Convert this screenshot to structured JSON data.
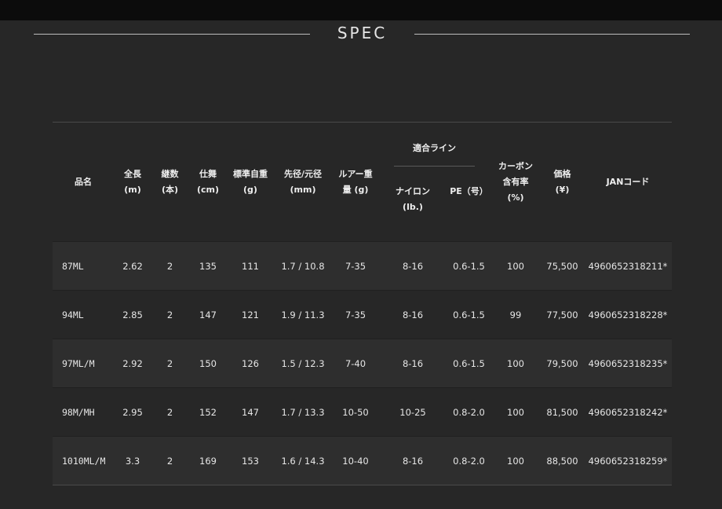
{
  "heading": {
    "title": "SPEC"
  },
  "headers": {
    "model": "品名",
    "length": "全長\n(m)",
    "sections": "継数\n(本)",
    "closed": "仕舞\n(cm)",
    "weight": "標準自重\n(g)",
    "diameter": "先径/元径\n(mm)",
    "lure": "ルアー重\n量 (g)",
    "line_group": "適合ライン",
    "nylon": "ナイロン\n(lb.)",
    "pe": "PE（号）",
    "carbon": "カーボン\n含有率\n(%)",
    "price": "価格\n(¥)",
    "jan": "JANコード"
  },
  "rows": [
    {
      "model": "87ML",
      "length": "2.62",
      "sections": "2",
      "closed": "135",
      "weight": "111",
      "diameter": "1.7 / 10.8",
      "lure": "7-35",
      "nylon": "8-16",
      "pe": "0.6-1.5",
      "carbon": "100",
      "price": "75,500",
      "jan": "4960652318211*"
    },
    {
      "model": "94ML",
      "length": "2.85",
      "sections": "2",
      "closed": "147",
      "weight": "121",
      "diameter": "1.9 / 11.3",
      "lure": "7-35",
      "nylon": "8-16",
      "pe": "0.6-1.5",
      "carbon": "99",
      "price": "77,500",
      "jan": "4960652318228*"
    },
    {
      "model": "97ML/M",
      "length": "2.92",
      "sections": "2",
      "closed": "150",
      "weight": "126",
      "diameter": "1.5 / 12.3",
      "lure": "7-40",
      "nylon": "8-16",
      "pe": "0.6-1.5",
      "carbon": "100",
      "price": "79,500",
      "jan": "4960652318235*"
    },
    {
      "model": "98M/MH",
      "length": "2.95",
      "sections": "2",
      "closed": "152",
      "weight": "147",
      "diameter": "1.7 / 13.3",
      "lure": "10-50",
      "nylon": "10-25",
      "pe": "0.8-2.0",
      "carbon": "100",
      "price": "81,500",
      "jan": "4960652318242*"
    },
    {
      "model": "1010ML/M",
      "length": "3.3",
      "sections": "2",
      "closed": "169",
      "weight": "153",
      "diameter": "1.6 / 14.3",
      "lure": "10-40",
      "nylon": "8-16",
      "pe": "0.8-2.0",
      "carbon": "100",
      "price": "88,500",
      "jan": "4960652318259*"
    }
  ]
}
